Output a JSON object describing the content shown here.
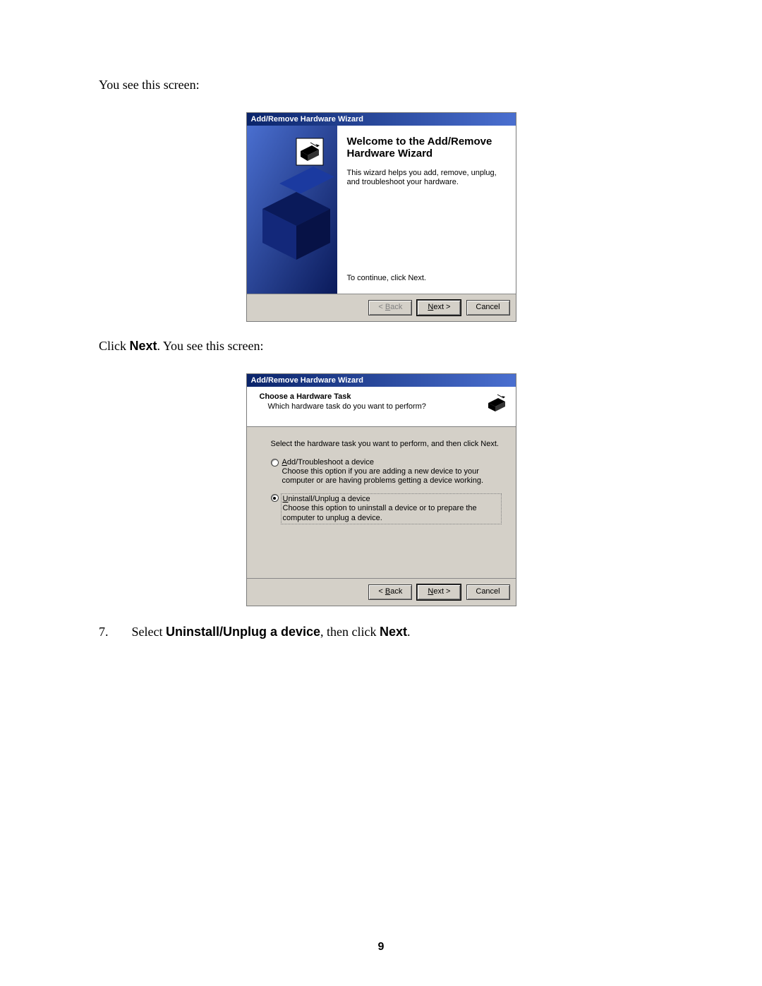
{
  "doc": {
    "intro": "You see this screen:",
    "intro2_pre": "Click ",
    "intro2_bold": "Next",
    "intro2_post": ". You see this screen:",
    "step_num": "7.",
    "step_pre": "Select ",
    "step_bold1": "Uninstall/Unplug a device",
    "step_mid": ", then click ",
    "step_bold2": "Next",
    "step_post": ".",
    "page_number": "9"
  },
  "wizard1": {
    "title": "Add/Remove Hardware Wizard",
    "heading": "Welcome to the Add/Remove Hardware Wizard",
    "desc": "This wizard helps you add, remove, unplug, and troubleshoot your hardware.",
    "continue": "To continue, click Next.",
    "back": "< Back",
    "next": "Next >",
    "next_ul": "N",
    "cancel": "Cancel"
  },
  "wizard2": {
    "title": "Add/Remove Hardware Wizard",
    "hdr_title": "Choose a Hardware Task",
    "hdr_sub": "Which hardware task do you want to perform?",
    "instr": "Select the hardware task you want to perform, and then click Next.",
    "opt1_label_ul": "A",
    "opt1_label_rest": "dd/Troubleshoot a device",
    "opt1_desc": "Choose this option if you are adding a new device to your computer or are having problems getting a device working.",
    "opt2_label_ul": "U",
    "opt2_label_rest": "ninstall/Unplug a device",
    "opt2_desc": "Choose this option to uninstall a device or to prepare the computer to unplug a device.",
    "back": "< Back",
    "back_ul": "B",
    "next": "Next >",
    "next_ul": "N",
    "cancel": "Cancel"
  }
}
